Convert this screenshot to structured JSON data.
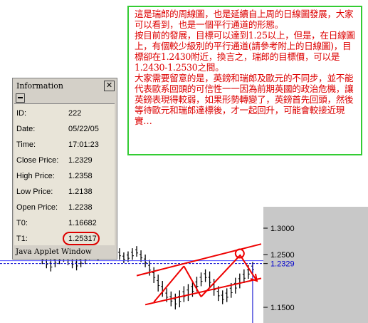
{
  "annotation": {
    "paragraphs": [
      "這是瑞郎的周線圖，也是延續自上周的日線圖發展，大家可以看到，也是一個平行通道的形態。",
      "按目前的發展，目標可以達到1.25以上，但是，在日線圖上，有個較少級別的平行通道(請參考附上的日線圖)，目標卻在1.2430附近，換言之，瑞郎的目標價，可以是1.2430-1.2530之間。",
      "大家需要留意的是，英鎊和瑞郎及歐元的不同步，並不能代表歐系回頭的可信性一一因為前期英國的政治危機，讓英鎊表現得較弱，如果形勢轉變了，英鎊首先回頭，然後等待歐元和瑞郎達標後，才一起回升，可能會較接近現實…"
    ],
    "border_color": "#33cc33",
    "text_color": "#dd0000"
  },
  "info_window": {
    "title": "Information",
    "close_glyph": "✕",
    "rows": [
      {
        "label": "ID:",
        "value": "222"
      },
      {
        "label": "Date:",
        "value": "05/22/05"
      },
      {
        "label": "Time:",
        "value": "17:01:23"
      },
      {
        "label": "Close Price:",
        "value": "1.2329"
      },
      {
        "label": "High Price:",
        "value": "1.2358"
      },
      {
        "label": "Low Price:",
        "value": "1.2138"
      },
      {
        "label": "Open Price:",
        "value": "1.2238"
      },
      {
        "label": "T0:",
        "value": "1.16682"
      },
      {
        "label": "T1:",
        "value": "1.25317"
      }
    ],
    "status": "Java Applet Window",
    "highlight_color": "#dd0000"
  },
  "chart_data": {
    "type": "candlestick",
    "title": "",
    "xlabel": "",
    "ylabel": "",
    "y_ticks": [
      "1.3000",
      "1.2500",
      "1.2329",
      "1.1500"
    ],
    "last_price": 1.2329,
    "last_price_label": "1.2329",
    "ylim": [
      1.13,
      1.34
    ],
    "bars": [
      {
        "h": 1.262,
        "l": 1.244
      },
      {
        "h": 1.268,
        "l": 1.25
      },
      {
        "h": 1.266,
        "l": 1.248
      },
      {
        "h": 1.272,
        "l": 1.256
      },
      {
        "h": 1.268,
        "l": 1.25
      },
      {
        "h": 1.262,
        "l": 1.244
      },
      {
        "h": 1.256,
        "l": 1.232
      },
      {
        "h": 1.246,
        "l": 1.224
      },
      {
        "h": 1.242,
        "l": 1.218
      },
      {
        "h": 1.248,
        "l": 1.226
      },
      {
        "h": 1.252,
        "l": 1.232
      },
      {
        "h": 1.258,
        "l": 1.236
      },
      {
        "h": 1.254,
        "l": 1.23
      },
      {
        "h": 1.246,
        "l": 1.224
      },
      {
        "h": 1.244,
        "l": 1.22
      },
      {
        "h": 1.248,
        "l": 1.226
      },
      {
        "h": 1.252,
        "l": 1.232
      },
      {
        "h": 1.26,
        "l": 1.24
      },
      {
        "h": 1.262,
        "l": 1.244
      },
      {
        "h": 1.258,
        "l": 1.238
      },
      {
        "h": 1.262,
        "l": 1.242
      },
      {
        "h": 1.266,
        "l": 1.246
      },
      {
        "h": 1.27,
        "l": 1.248
      },
      {
        "h": 1.268,
        "l": 1.244
      },
      {
        "h": 1.262,
        "l": 1.24
      },
      {
        "h": 1.254,
        "l": 1.234
      },
      {
        "h": 1.256,
        "l": 1.236
      },
      {
        "h": 1.262,
        "l": 1.24
      },
      {
        "h": 1.266,
        "l": 1.246
      },
      {
        "h": 1.258,
        "l": 1.236
      },
      {
        "h": 1.25,
        "l": 1.226
      },
      {
        "h": 1.24,
        "l": 1.21
      },
      {
        "h": 1.226,
        "l": 1.196
      },
      {
        "h": 1.212,
        "l": 1.18
      },
      {
        "h": 1.2,
        "l": 1.17
      },
      {
        "h": 1.186,
        "l": 1.16
      },
      {
        "h": 1.18,
        "l": 1.152
      },
      {
        "h": 1.176,
        "l": 1.146
      },
      {
        "h": 1.182,
        "l": 1.15
      },
      {
        "h": 1.19,
        "l": 1.16
      },
      {
        "h": 1.194,
        "l": 1.162
      },
      {
        "h": 1.2,
        "l": 1.17
      },
      {
        "h": 1.208,
        "l": 1.18
      },
      {
        "h": 1.216,
        "l": 1.19
      },
      {
        "h": 1.222,
        "l": 1.198
      },
      {
        "h": 1.218,
        "l": 1.186
      },
      {
        "h": 1.204,
        "l": 1.172
      },
      {
        "h": 1.19,
        "l": 1.162
      },
      {
        "h": 1.182,
        "l": 1.156
      },
      {
        "h": 1.186,
        "l": 1.16
      },
      {
        "h": 1.196,
        "l": 1.168
      },
      {
        "h": 1.206,
        "l": 1.176
      },
      {
        "h": 1.214,
        "l": 1.186
      },
      {
        "h": 1.222,
        "l": 1.196
      },
      {
        "h": 1.23,
        "l": 1.204
      },
      {
        "h": 1.2358,
        "l": 1.2138
      }
    ],
    "pattern": {
      "type": "parallel-channel",
      "upper_line": [
        {
          "bar": 31,
          "y": 1.21
        },
        {
          "bar": 60,
          "y": 1.27
        }
      ],
      "lower_line": [
        {
          "bar": 33,
          "y": 1.155
        },
        {
          "bar": 60,
          "y": 1.205
        }
      ],
      "zigzag": [
        {
          "bar": 35,
          "y": 1.16
        },
        {
          "bar": 42,
          "y": 1.228
        },
        {
          "bar": 46,
          "y": 1.17
        },
        {
          "bar": 55,
          "y": 1.248
        }
      ],
      "target_arrow": [
        {
          "bar": 55,
          "y": 1.25
        },
        {
          "bar": 59,
          "y": 1.2
        }
      ],
      "target_circle": {
        "bar": 55,
        "y": 1.252
      },
      "color": "#ee0000"
    },
    "grid": false,
    "price_color": "#0000cc",
    "axis_background": "#c8c8c8"
  }
}
